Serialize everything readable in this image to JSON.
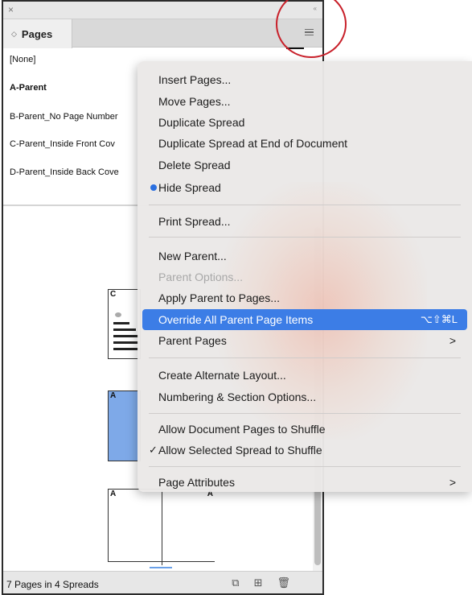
{
  "panel": {
    "close_icon": "×",
    "collapse_icon": "«",
    "tab_label": "Pages",
    "parents": [
      "[None]",
      "A-Parent",
      "B-Parent_No Page Number",
      "C-Parent_Inside Front Cov",
      "D-Parent_Inside Back Cove"
    ],
    "thumb_letters": [
      "C",
      "A",
      "A",
      "A"
    ],
    "footer_text": "7 Pages in 4 Spreads",
    "footer_icons": [
      "page-size-icon",
      "new-page-icon",
      "trash-icon"
    ]
  },
  "menu": {
    "items": [
      {
        "label": "Insert Pages..."
      },
      {
        "label": "Move Pages..."
      },
      {
        "label": "Duplicate Spread"
      },
      {
        "label": "Duplicate Spread at End of Document"
      },
      {
        "label": "Delete Spread"
      },
      {
        "label": "Hide Spread"
      },
      {
        "label": "Print Spread..."
      },
      {
        "label": "New Parent..."
      },
      {
        "label": "Parent Options..."
      },
      {
        "label": "Apply Parent to Pages..."
      },
      {
        "label": "Override All Parent Page Items",
        "shortcut": "⌥⇧⌘L"
      },
      {
        "label": "Parent Pages"
      },
      {
        "label": "Create Alternate Layout..."
      },
      {
        "label": "Numbering & Section Options..."
      },
      {
        "label": "Allow Document Pages to Shuffle"
      },
      {
        "label": "Allow Selected Spread to Shuffle"
      },
      {
        "label": "Page Attributes"
      }
    ],
    "checkmark": "✓",
    "chevron": ">"
  },
  "colors": {
    "highlight": "#3c7de6",
    "annotation_circle": "#c8202a",
    "selected_page": "#7ea9e8"
  }
}
